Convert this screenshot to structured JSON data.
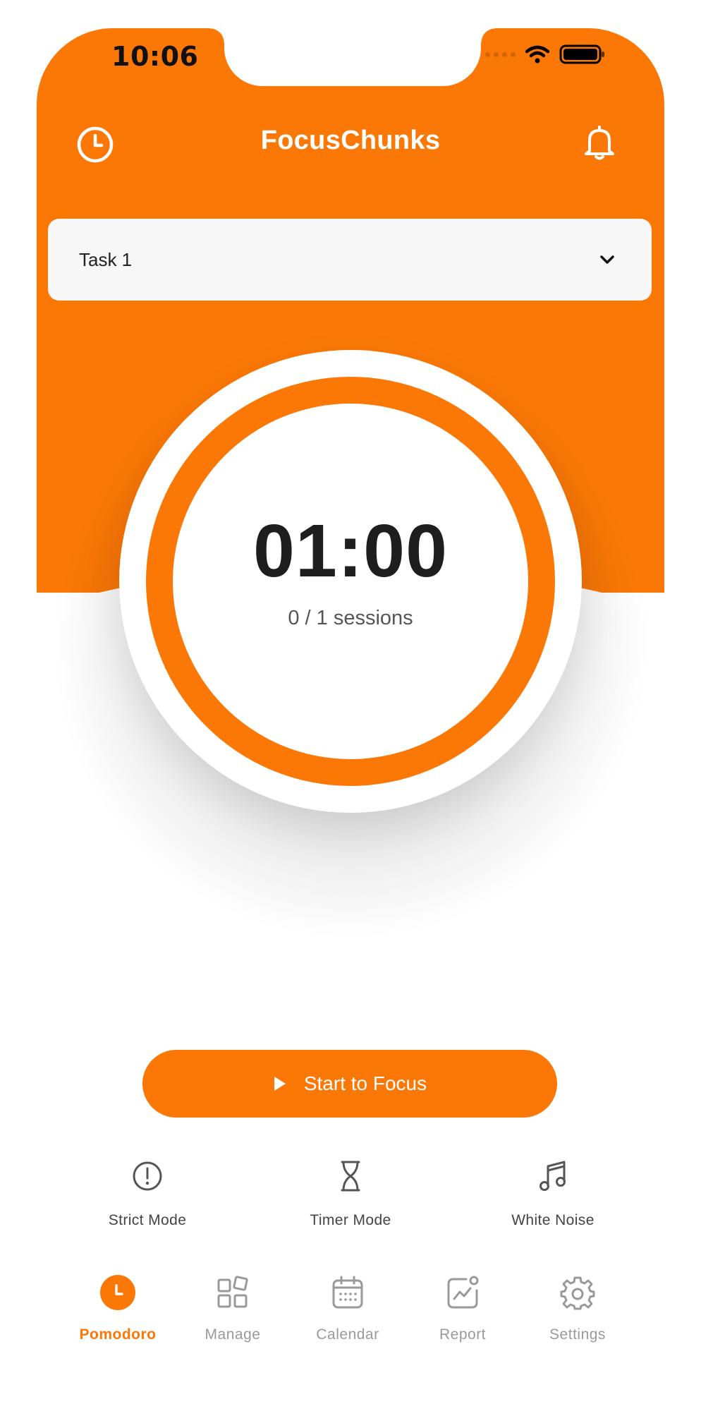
{
  "status_bar": {
    "time": "10:06"
  },
  "header": {
    "title": "FocusChunks"
  },
  "task_select": {
    "selected": "Task 1"
  },
  "timer": {
    "time": "01:00",
    "sessions": "0 / 1 sessions"
  },
  "start_button": {
    "label": "Start to Focus"
  },
  "tools": [
    {
      "label": "Strict Mode",
      "icon": "alert-circle-icon"
    },
    {
      "label": "Timer Mode",
      "icon": "hourglass-icon"
    },
    {
      "label": "White Noise",
      "icon": "music-note-icon"
    }
  ],
  "tabs": [
    {
      "label": "Pomodoro",
      "icon": "clock-icon",
      "active": true
    },
    {
      "label": "Manage",
      "icon": "grid-icon"
    },
    {
      "label": "Calendar",
      "icon": "calendar-icon"
    },
    {
      "label": "Report",
      "icon": "chart-icon"
    },
    {
      "label": "Settings",
      "icon": "gear-icon"
    }
  ],
  "colors": {
    "accent": "#FC7806",
    "text_dark": "#1e1e1e",
    "tab_inactive": "#999999"
  }
}
